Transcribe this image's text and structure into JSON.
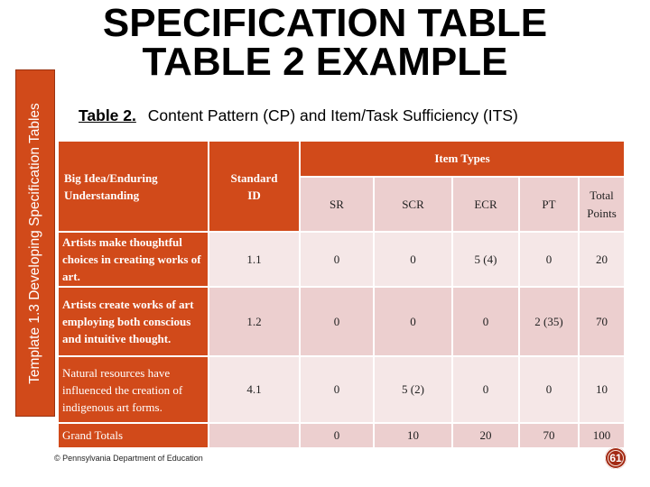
{
  "sidebar": {
    "label": "Template 1.3 Developing Specification Tables"
  },
  "title": {
    "line1": "SPECIFICATION TABLE",
    "line2": "TABLE 2 EXAMPLE"
  },
  "subtitle": {
    "label": "Table 2.",
    "text": "Content Pattern (CP) and Item/Task Sufficiency (ITS)"
  },
  "table": {
    "header": {
      "big_idea": "Big Idea/Enduring Understanding",
      "standard_id": "Standard ID",
      "item_types": "Item Types",
      "columns": [
        "SR",
        "SCR",
        "ECR",
        "PT",
        "Total Points"
      ]
    },
    "rows": [
      {
        "big_idea": "Artists make thoughtful choices in creating works of art.",
        "standard_id": "1.1",
        "sr": "0",
        "scr": "0",
        "ecr": "5 (4)",
        "pt": "0",
        "total": "20"
      },
      {
        "big_idea": "Artists create works of art employing both conscious and intuitive thought.",
        "standard_id": "1.2",
        "sr": "0",
        "scr": "0",
        "ecr": "0",
        "pt": "2 (35)",
        "total": "70"
      },
      {
        "big_idea": "Natural resources have influenced the creation of indigenous art forms.",
        "standard_id": "4.1",
        "sr": "0",
        "scr": "5 (2)",
        "ecr": "0",
        "pt": "0",
        "total": "10"
      }
    ],
    "grand_totals": {
      "label": "Grand Totals",
      "standard_id": "",
      "sr": "0",
      "scr": "10",
      "ecr": "20",
      "pt": "70",
      "total": "100"
    }
  },
  "footer": {
    "copyright": "© Pennsylvania Department of Education"
  },
  "page_number": "61",
  "colors": {
    "accent": "#d14a1a",
    "cell_light": "#f5e7e7",
    "cell_dark": "#eccfcf",
    "badge": "#a32a14"
  }
}
